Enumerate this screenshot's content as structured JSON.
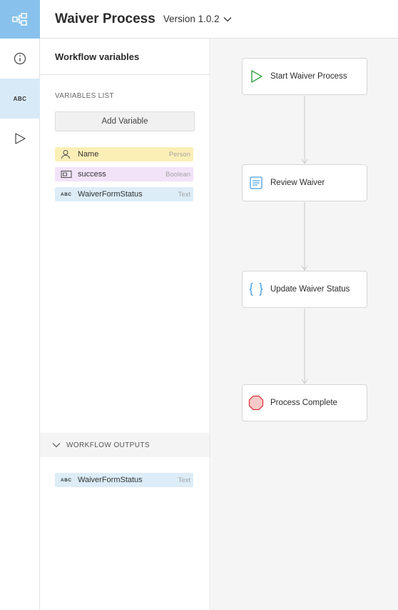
{
  "header": {
    "title": "Waiver Process",
    "version": "Version 1.0.2"
  },
  "rail": {
    "abc_label": "ABC"
  },
  "panel": {
    "title": "Workflow variables",
    "variables_label": "VARIABLES LIST",
    "add_variable_label": "Add Variable",
    "variables": [
      {
        "name": "Name",
        "type": "Person",
        "icon": "person-icon"
      },
      {
        "name": "success",
        "type": "Boolean",
        "icon": "boolean-icon"
      },
      {
        "name": "WaiverFormStatus",
        "type": "Text",
        "icon": "abc-icon",
        "icon_text": "ABC"
      }
    ],
    "outputs_label": "WORKFLOW OUTPUTS",
    "outputs": [
      {
        "name": "WaiverFormStatus",
        "type": "Text",
        "icon": "abc-icon",
        "icon_text": "ABC"
      }
    ]
  },
  "workflow": {
    "steps": [
      {
        "label": "Start Waiver Process",
        "icon": "start-play-icon"
      },
      {
        "label": "Review Waiver",
        "icon": "form-icon"
      },
      {
        "label": "Update Waiver Status",
        "icon": "braces-icon"
      },
      {
        "label": "Process Complete",
        "icon": "stop-icon"
      }
    ]
  },
  "colors": {
    "accent": "#88c2ec",
    "rail_active": "#d8eaf8",
    "person": "#fcefb6",
    "boolean": "#f2e3f8",
    "text": "#dcedf8",
    "start_green": "#3aa84a",
    "stop_red": "#d93a3a",
    "braces_blue": "#4a9fe0"
  }
}
